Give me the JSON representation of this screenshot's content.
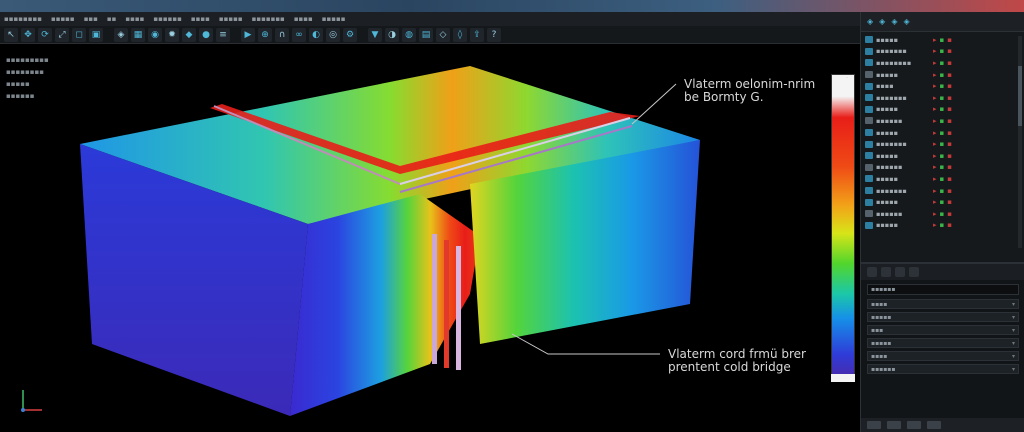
{
  "menu": [
    "▪▪▪▪▪▪▪▪",
    "▪▪▪▪▪",
    "▪▪▪",
    "▪▪",
    "▪▪▪▪",
    "▪▪▪▪▪▪",
    "▪▪▪▪",
    "▪▪▪▪▪",
    "▪▪▪▪▪▪▪",
    "▪▪▪▪",
    "▪▪▪▪▪"
  ],
  "toolbar_icons": [
    "cursor-icon",
    "move-icon",
    "rotate-icon",
    "scale-icon",
    "select-icon",
    "box-icon",
    "cube-icon",
    "grid-icon",
    "camera-icon",
    "light-icon",
    "mesh-icon",
    "sphere-icon",
    "layers-icon",
    "render-icon",
    "snap-icon",
    "magnet-icon",
    "link-icon",
    "view-icon",
    "eye-icon",
    "settings-icon",
    "filter-icon",
    "palette-icon",
    "material-icon",
    "texture-icon",
    "node-icon",
    "graph-icon",
    "export-icon",
    "help-icon"
  ],
  "stats": [
    "▪▪▪▪▪▪▪▪▪",
    "▪▪▪▪▪▪▪▪",
    "▪▪▪▪▪",
    "▪▪▪▪▪▪"
  ],
  "annotations": {
    "top": [
      "Vlaterm oelonim-nrim",
      "be Bormty G."
    ],
    "bottom": [
      "Vlaterm cord frmü brer",
      "prentent cold bridge"
    ]
  },
  "legend": {
    "top_label": "·"
  },
  "colors": {
    "hot": "#e81e18",
    "warm": "#f2a318",
    "mid": "#52d62c",
    "cool": "#1690e8",
    "cold": "#3a2fc8"
  },
  "outliner": {
    "header_icons": [
      "arrow-icon",
      "camera-icon",
      "eye-icon",
      "filter-icon"
    ],
    "rows": [
      {
        "name": "▪▪▪▪▪",
        "icon": "object"
      },
      {
        "name": "▪▪▪▪▪▪▪",
        "icon": "object"
      },
      {
        "name": "▪▪▪▪▪▪▪▪",
        "icon": "object"
      },
      {
        "name": "▪▪▪▪▪",
        "icon": "object"
      },
      {
        "name": "▪▪▪▪",
        "icon": "object"
      },
      {
        "name": "▪▪▪▪▪▪▪",
        "icon": "object"
      },
      {
        "name": "▪▪▪▪▪",
        "icon": "object"
      },
      {
        "name": "▪▪▪▪▪▪",
        "icon": "object"
      },
      {
        "name": "▪▪▪▪▪",
        "icon": "object"
      },
      {
        "name": "▪▪▪▪▪▪▪",
        "icon": "object"
      },
      {
        "name": "▪▪▪▪▪",
        "icon": "object"
      },
      {
        "name": "▪▪▪▪▪▪",
        "icon": "object"
      },
      {
        "name": "▪▪▪▪▪",
        "icon": "object"
      },
      {
        "name": "▪▪▪▪▪▪▪",
        "icon": "object"
      },
      {
        "name": "▪▪▪▪▪",
        "icon": "object"
      },
      {
        "name": "▪▪▪▪▪▪",
        "icon": "object"
      },
      {
        "name": "▪▪▪▪▪",
        "icon": "object"
      }
    ]
  },
  "properties": {
    "field": "▪▪▪▪▪▪",
    "rows": [
      "▪▪▪▪",
      "▪▪▪▪▪",
      "▪▪▪",
      "▪▪▪▪▪",
      "▪▪▪▪",
      "▪▪▪▪▪▪"
    ]
  }
}
